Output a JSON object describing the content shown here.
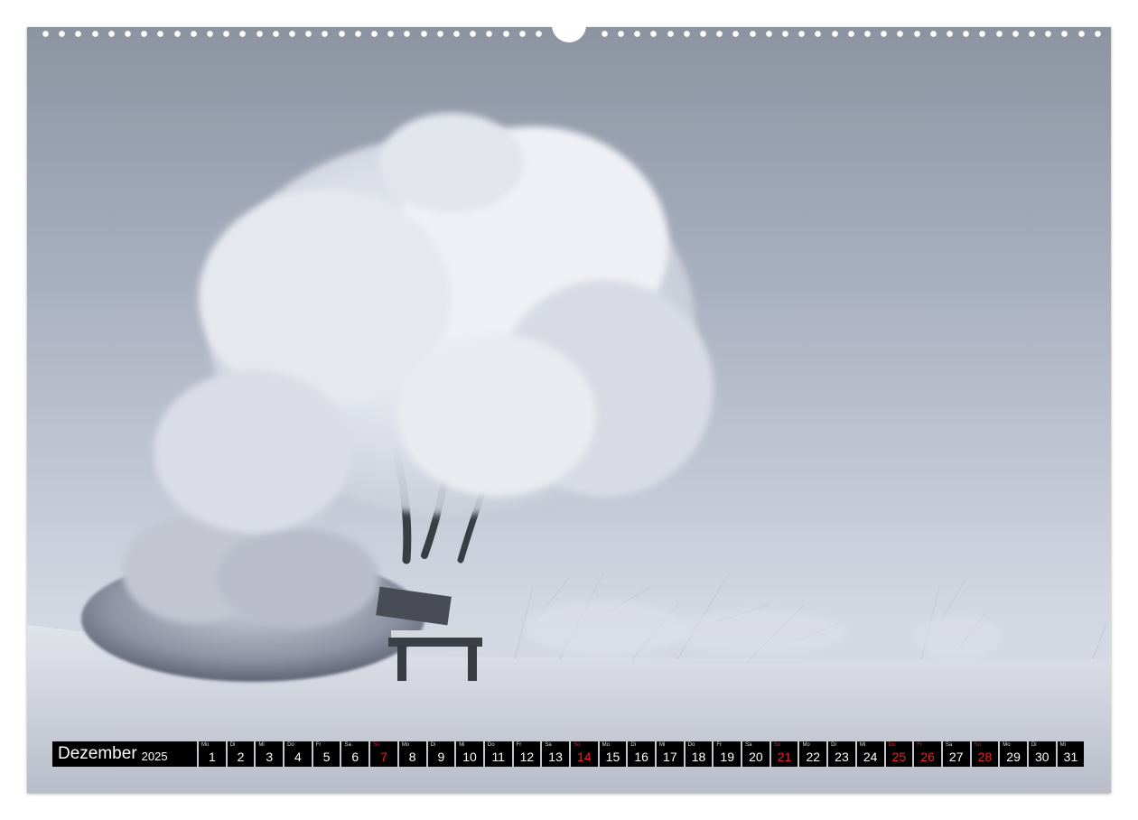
{
  "calendar": {
    "month": "Dezember",
    "year": "2025",
    "days": [
      {
        "wd": "Mo",
        "n": "1",
        "red": false
      },
      {
        "wd": "Di",
        "n": "2",
        "red": false
      },
      {
        "wd": "Mi",
        "n": "3",
        "red": false
      },
      {
        "wd": "Do",
        "n": "4",
        "red": false
      },
      {
        "wd": "Fr",
        "n": "5",
        "red": false
      },
      {
        "wd": "Sa",
        "n": "6",
        "red": false
      },
      {
        "wd": "So",
        "n": "7",
        "red": true
      },
      {
        "wd": "Mo",
        "n": "8",
        "red": false
      },
      {
        "wd": "Di",
        "n": "9",
        "red": false
      },
      {
        "wd": "Mi",
        "n": "10",
        "red": false
      },
      {
        "wd": "Do",
        "n": "11",
        "red": false
      },
      {
        "wd": "Fr",
        "n": "12",
        "red": false
      },
      {
        "wd": "Sa",
        "n": "13",
        "red": false
      },
      {
        "wd": "So",
        "n": "14",
        "red": true
      },
      {
        "wd": "Mo",
        "n": "15",
        "red": false
      },
      {
        "wd": "Di",
        "n": "16",
        "red": false
      },
      {
        "wd": "Mi",
        "n": "17",
        "red": false
      },
      {
        "wd": "Do",
        "n": "18",
        "red": false
      },
      {
        "wd": "Fr",
        "n": "19",
        "red": false
      },
      {
        "wd": "Sa",
        "n": "20",
        "red": false
      },
      {
        "wd": "So",
        "n": "21",
        "red": true
      },
      {
        "wd": "Mo",
        "n": "22",
        "red": false
      },
      {
        "wd": "Di",
        "n": "23",
        "red": false
      },
      {
        "wd": "Mi",
        "n": "24",
        "red": false
      },
      {
        "wd": "Do",
        "n": "25",
        "red": true
      },
      {
        "wd": "Fr",
        "n": "26",
        "red": true
      },
      {
        "wd": "Sa",
        "n": "27",
        "red": false
      },
      {
        "wd": "So",
        "n": "28",
        "red": true
      },
      {
        "wd": "Mo",
        "n": "29",
        "red": false
      },
      {
        "wd": "Di",
        "n": "30",
        "red": false
      },
      {
        "wd": "Mi",
        "n": "31",
        "red": false
      }
    ]
  },
  "colors": {
    "calendar_bg": "#000000",
    "holiday": "#e8222a",
    "sky_top": "#8d95a3",
    "sky_bottom": "#d9dce6"
  }
}
